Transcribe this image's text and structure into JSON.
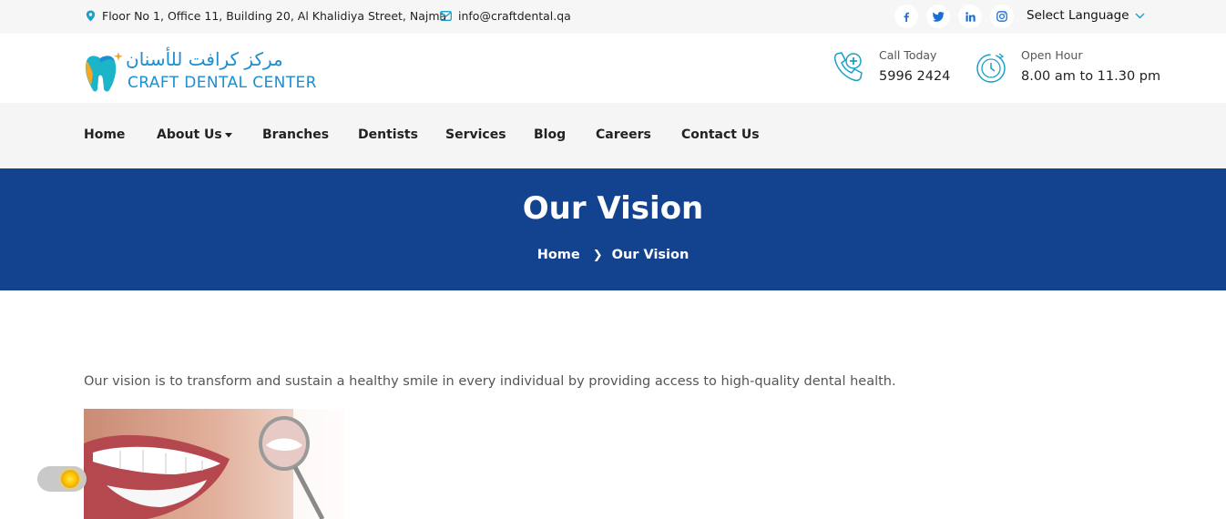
{
  "topbar": {
    "address": "Floor No 1, Office 11, Building 20, Al Khalidiya Street, Najma",
    "email": "info@craftdental.qa",
    "social": [
      "facebook-icon",
      "twitter-icon",
      "linkedin-icon",
      "instagram-icon"
    ],
    "language_label": "Select Language"
  },
  "header": {
    "logo_arabic": "مركز كرافت للأسنان",
    "logo_english": "CRAFT DENTAL CENTER",
    "call_label": "Call Today",
    "call_value": "5996 2424",
    "hours_label": "Open Hour",
    "hours_value": "8.00 am to 11.30 pm"
  },
  "nav": {
    "items": [
      "Home",
      "About Us",
      "Branches",
      "Dentists",
      "Services",
      "Blog",
      "Careers",
      "Contact Us"
    ]
  },
  "banner": {
    "title": "Our Vision",
    "breadcrumb": [
      "Home",
      "Our Vision"
    ]
  },
  "content": {
    "vision_text": "Our vision is to transform and sustain a healthy smile in every individual by providing access to high-quality dental health."
  },
  "colors": {
    "brand_blue": "#13438f",
    "logo_blue": "#1b8fd2",
    "icon_teal": "#1aa0c9"
  }
}
